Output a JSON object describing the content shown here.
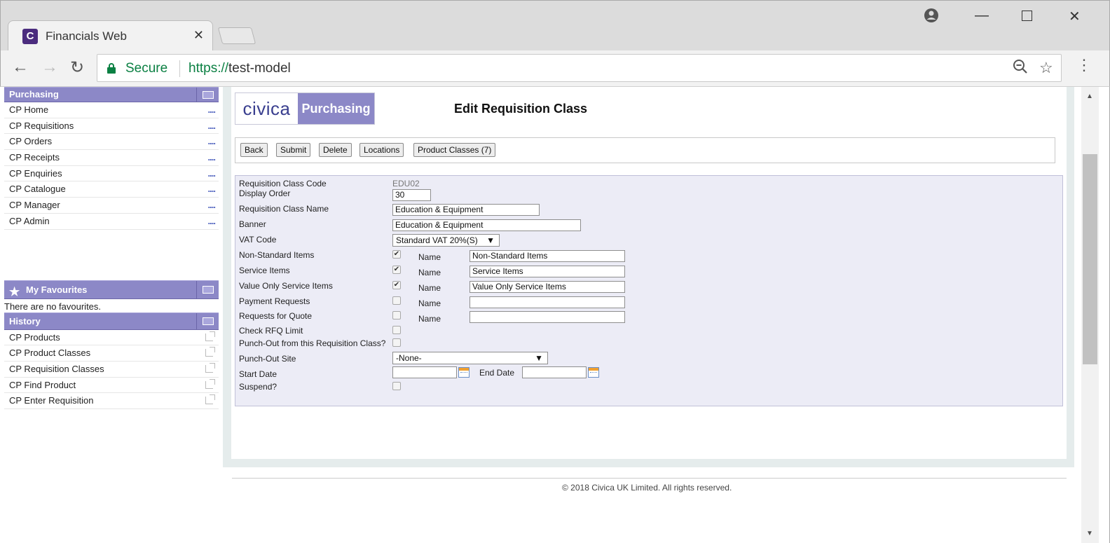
{
  "browser": {
    "tab_title": "Financials Web",
    "tab_favicon_letter": "C",
    "secure_label": "Secure",
    "url_scheme": "https://",
    "url_host": "test-model"
  },
  "sidebar": {
    "purchasing_title": "Purchasing",
    "menu_items": [
      {
        "label": "CP Home"
      },
      {
        "label": "CP Requisitions"
      },
      {
        "label": "CP Orders"
      },
      {
        "label": "CP Receipts"
      },
      {
        "label": "CP Enquiries"
      },
      {
        "label": "CP Catalogue"
      },
      {
        "label": "CP Manager"
      },
      {
        "label": "CP Admin"
      }
    ],
    "more_glyph": "....",
    "favourites_title": "My Favourites",
    "favourites_empty": "There are no favourites.",
    "history_title": "History",
    "history_items": [
      {
        "label": "CP Products"
      },
      {
        "label": "CP Product Classes"
      },
      {
        "label": "CP Requisition Classes"
      },
      {
        "label": "CP Find Product"
      },
      {
        "label": "CP Enter Requisition"
      }
    ]
  },
  "logo": {
    "brand": "civica",
    "module": "Purchasing"
  },
  "page_title": "Edit Requisition Class",
  "buttons": {
    "back": "Back",
    "submit": "Submit",
    "delete": "Delete",
    "locations": "Locations",
    "product_classes": "Product Classes (7)"
  },
  "form": {
    "code_label": "Requisition Class Code",
    "code_value": "EDU02",
    "display_order_label": "Display Order",
    "display_order_value": "30",
    "name_label": "Requisition Class Name",
    "name_value": "Education & Equipment",
    "banner_label": "Banner",
    "banner_value": "Education & Equipment",
    "vat_label": "VAT Code",
    "vat_value": "Standard VAT 20%(S)",
    "name_sub_label": "Name",
    "non_standard_label": "Non-Standard Items",
    "non_standard_checked": true,
    "non_standard_name": "Non-Standard Items",
    "service_label": "Service Items",
    "service_checked": true,
    "service_name": "Service Items",
    "value_only_label": "Value Only Service Items",
    "value_only_checked": true,
    "value_only_name": "Value Only Service Items",
    "payment_label": "Payment Requests",
    "payment_checked": false,
    "payment_name": "",
    "rfq_label": "Requests for Quote",
    "rfq_checked": false,
    "rfq_name": "",
    "check_rfq_label": "Check RFQ Limit",
    "check_rfq_checked": false,
    "punchout_label": "Punch-Out from this Requisition Class?",
    "punchout_checked": false,
    "punchout_site_label": "Punch-Out Site",
    "punchout_site_value": "-None-",
    "start_date_label": "Start Date",
    "start_date_value": "",
    "end_date_label": "End Date",
    "end_date_value": "",
    "suspend_label": "Suspend?",
    "suspend_checked": false
  },
  "footer": "© 2018 Civica UK Limited. All rights reserved.",
  "colors": {
    "panel_header": "#8c88c7",
    "form_background": "#ececf6",
    "secure_green": "#0b8043"
  }
}
